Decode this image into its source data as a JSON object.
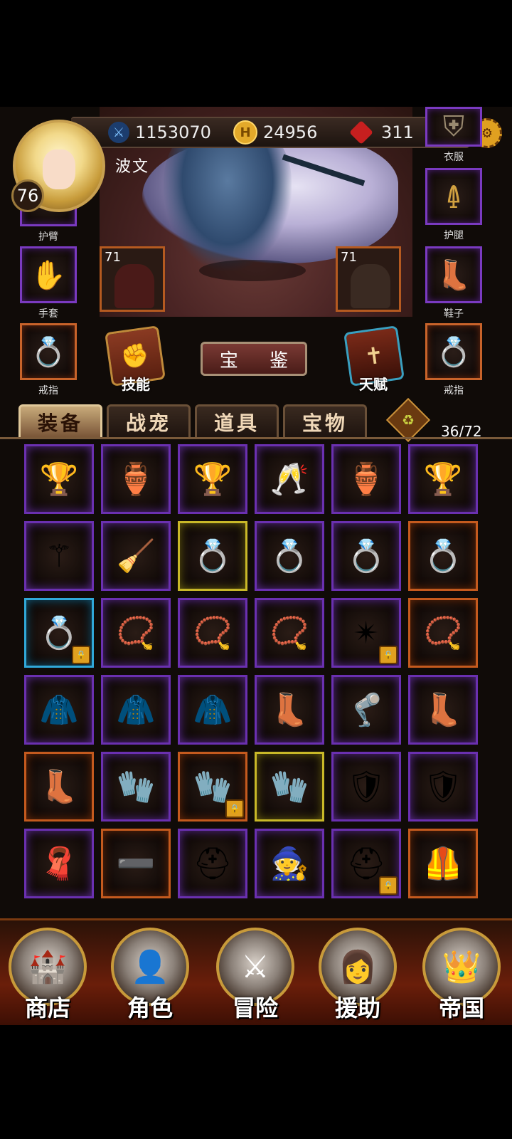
{
  "player": {
    "name": "波文",
    "level": "76"
  },
  "resources": {
    "power": "1153070",
    "gold": "24956",
    "gems": "311"
  },
  "equipment_slots": {
    "arm": "护臂",
    "clothes": "衣服",
    "gloves": "手套",
    "legs": "护腿",
    "shoes": "鞋子",
    "ring_left": "戒指",
    "ring_right": "戒指"
  },
  "heroes": {
    "left_level": "71",
    "right_level": "71"
  },
  "actions": {
    "skill": "技能",
    "appraise": "宝 鉴",
    "talent": "天赋"
  },
  "tabs": [
    "装备",
    "战宠",
    "道具",
    "宝物"
  ],
  "inventory": {
    "capacity": "36/72",
    "items": [
      {
        "icon": "golden-trophy",
        "rarity": "purple"
      },
      {
        "icon": "bronze-winged-cup",
        "rarity": "purple"
      },
      {
        "icon": "ornate-goblet",
        "rarity": "purple"
      },
      {
        "icon": "golden-horn-cup",
        "rarity": "purple"
      },
      {
        "icon": "small-golden-chalice",
        "rarity": "purple"
      },
      {
        "icon": "treasure-bowl",
        "rarity": "purple"
      },
      {
        "icon": "dark-feather-charm",
        "rarity": "purple"
      },
      {
        "icon": "berry-broom",
        "rarity": "purple"
      },
      {
        "icon": "ruby-bronze-ring",
        "rarity": "yellow"
      },
      {
        "icon": "amber-silver-ring",
        "rarity": "purple"
      },
      {
        "icon": "amber-silver-ring",
        "rarity": "purple"
      },
      {
        "icon": "emerald-violet-ring",
        "rarity": "orange"
      },
      {
        "icon": "sapphire-silver-ring",
        "rarity": "blue",
        "locked": true
      },
      {
        "icon": "amethyst-necklace",
        "rarity": "purple"
      },
      {
        "icon": "sapphire-pendant",
        "rarity": "purple"
      },
      {
        "icon": "ruby-gold-necklace",
        "rarity": "purple"
      },
      {
        "icon": "star-amulet",
        "rarity": "purple",
        "locked": true
      },
      {
        "icon": "garnet-pendant",
        "rarity": "orange"
      },
      {
        "icon": "blue-cape",
        "rarity": "purple"
      },
      {
        "icon": "leather-cloak",
        "rarity": "purple"
      },
      {
        "icon": "fur-cloak",
        "rarity": "purple"
      },
      {
        "icon": "blue-boot",
        "rarity": "purple"
      },
      {
        "icon": "steel-greave",
        "rarity": "purple"
      },
      {
        "icon": "brown-boot",
        "rarity": "purple"
      },
      {
        "icon": "winged-boot",
        "rarity": "orange"
      },
      {
        "icon": "orange-glove",
        "rarity": "purple"
      },
      {
        "icon": "iron-gauntlet",
        "rarity": "orange",
        "locked": true
      },
      {
        "icon": "golden-gauntlet",
        "rarity": "yellow"
      },
      {
        "icon": "steel-pauldron",
        "rarity": "purple"
      },
      {
        "icon": "dark-bracer",
        "rarity": "purple"
      },
      {
        "icon": "blue-scarf",
        "rarity": "purple"
      },
      {
        "icon": "gold-belt",
        "rarity": "orange"
      },
      {
        "icon": "leather-helmet",
        "rarity": "purple"
      },
      {
        "icon": "blue-hood",
        "rarity": "purple"
      },
      {
        "icon": "golden-helm",
        "rarity": "purple",
        "locked": true
      },
      {
        "icon": "gold-scale-armor",
        "rarity": "orange"
      }
    ]
  },
  "nav": [
    "商店",
    "角色",
    "冒险",
    "援助",
    "帝国"
  ],
  "colors": {
    "purple": "#6a30b0",
    "orange": "#c45a1e",
    "yellow": "#c8b828",
    "blue": "#30a8d8"
  }
}
